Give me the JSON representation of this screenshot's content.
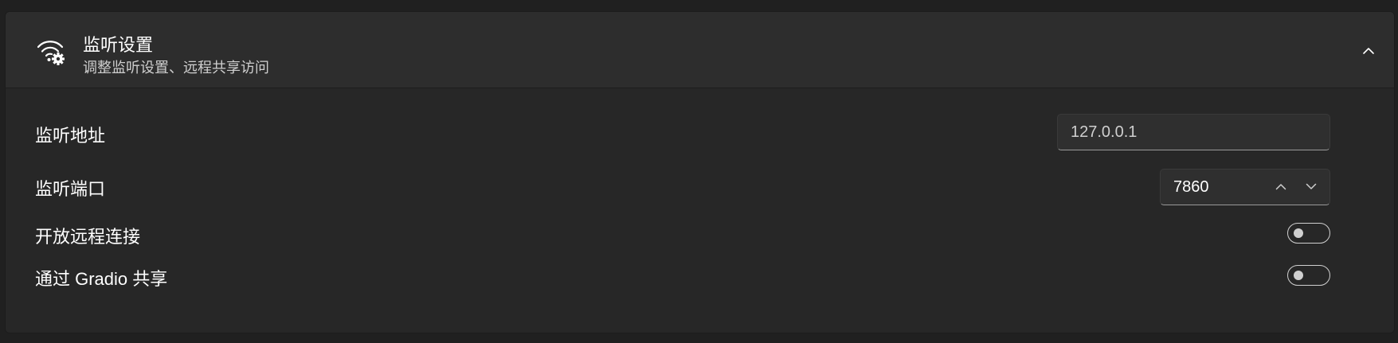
{
  "section": {
    "title": "监听设置",
    "subtitle": "调整监听设置、远程共享访问",
    "icon": "wifi-gear-icon",
    "collapse_icon": "chevron-up-icon"
  },
  "settings": {
    "address": {
      "label": "监听地址",
      "value": "127.0.0.1"
    },
    "port": {
      "label": "监听端口",
      "value": "7860"
    },
    "remote": {
      "label": "开放远程连接",
      "enabled": false
    },
    "gradio": {
      "label": "通过 Gradio 共享",
      "enabled": false
    }
  },
  "colors": {
    "background": "#202020",
    "card": "#2b2b2b",
    "text": "#ffffff",
    "subtext": "#cfcfcf"
  }
}
